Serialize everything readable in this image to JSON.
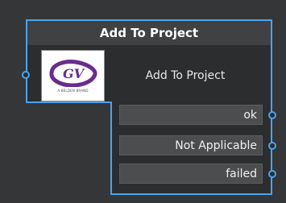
{
  "node": {
    "title": "Add To Project",
    "label": "Add To Project",
    "logo": {
      "brand": "GV",
      "tagline": "A BELDEN BRAND",
      "color": "#6a2c8c"
    },
    "outputs": [
      {
        "label": "ok"
      },
      {
        "label": "Not Applicable"
      },
      {
        "label": "failed"
      }
    ]
  },
  "colors": {
    "accent": "#4aa3ef",
    "background": "#343638",
    "node_body": "#2b2d2f",
    "output_row": "#4b4d4f"
  }
}
